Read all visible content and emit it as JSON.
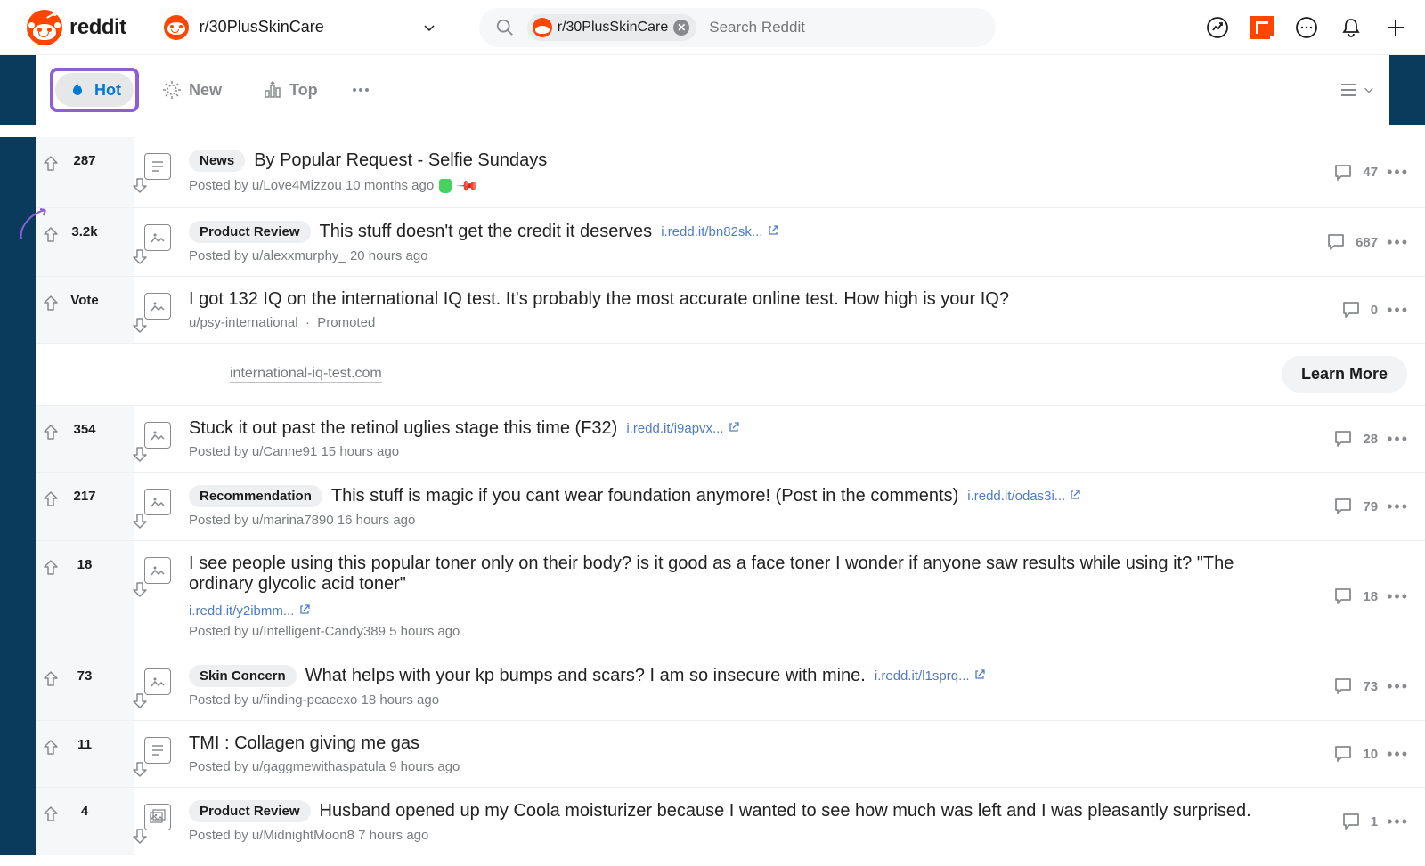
{
  "header": {
    "logo_text": "reddit",
    "community": "r/30PlusSkinCare",
    "search_chip": "r/30PlusSkinCare",
    "search_placeholder": "Search Reddit"
  },
  "sort": {
    "hot": "Hot",
    "new": "New",
    "top": "Top"
  },
  "posts": [
    {
      "score": "287",
      "thumb": "text",
      "flair": "News",
      "title": "By Popular Request - Selfie Sundays",
      "link": "",
      "author": "u/Love4Mizzou",
      "age": "10 months ago",
      "shield": true,
      "pinned": true,
      "comments": "47"
    },
    {
      "score": "3.2k",
      "thumb": "image",
      "flair": "Product Review",
      "title": "This stuff doesn't get the credit it deserves",
      "link": "i.redd.it/bn82sk...",
      "author": "u/alexxmurphy_",
      "age": "20 hours ago",
      "comments": "687"
    },
    {
      "score": "Vote",
      "thumb": "image",
      "flair": "",
      "title": "I got 132 IQ on the international IQ test. It's probably the most accurate online test. How high is your IQ?",
      "link": "",
      "author": "u/psy-international",
      "age": "Promoted",
      "comments": "0",
      "promoted": true,
      "promo_domain": "international-iq-test.com",
      "promo_cta": "Learn More"
    },
    {
      "score": "354",
      "thumb": "image",
      "flair": "",
      "title": "Stuck it out past the retinol uglies stage this time (F32)",
      "link": "i.redd.it/i9apvx...",
      "author": "u/Canne91",
      "age": "15 hours ago",
      "comments": "28"
    },
    {
      "score": "217",
      "thumb": "image",
      "flair": "Recommendation",
      "title": "This stuff is magic if you cant wear foundation anymore! (Post in the comments)",
      "link": "i.redd.it/odas3i...",
      "author": "u/marina7890",
      "age": "16 hours ago",
      "comments": "79"
    },
    {
      "score": "18",
      "thumb": "image",
      "flair": "",
      "title": "I see people using this popular toner only on their body? is it good as a face toner I wonder if anyone saw results while using it? \"The ordinary glycolic acid toner\"",
      "link": "i.redd.it/y2ibmm...",
      "author": "u/Intelligent-Candy389",
      "age": "5 hours ago",
      "comments": "18"
    },
    {
      "score": "73",
      "thumb": "image",
      "flair": "Skin Concern",
      "title": "What helps with your kp bumps and scars? I am so insecure with mine.",
      "link": "i.redd.it/l1sprq...",
      "author": "u/finding-peacexo",
      "age": "18 hours ago",
      "comments": "73"
    },
    {
      "score": "11",
      "thumb": "text",
      "flair": "",
      "title": "TMI : Collagen giving me gas",
      "link": "",
      "author": "u/gaggmewithaspatula",
      "age": "9 hours ago",
      "comments": "10"
    },
    {
      "score": "4",
      "thumb": "gallery",
      "flair": "Product Review",
      "title": "Husband opened up my Coola moisturizer because I wanted to see how much was left and I was pleasantly surprised.",
      "link": "",
      "author": "u/MidnightMoon8",
      "age": "7 hours ago",
      "comments": "1"
    }
  ]
}
